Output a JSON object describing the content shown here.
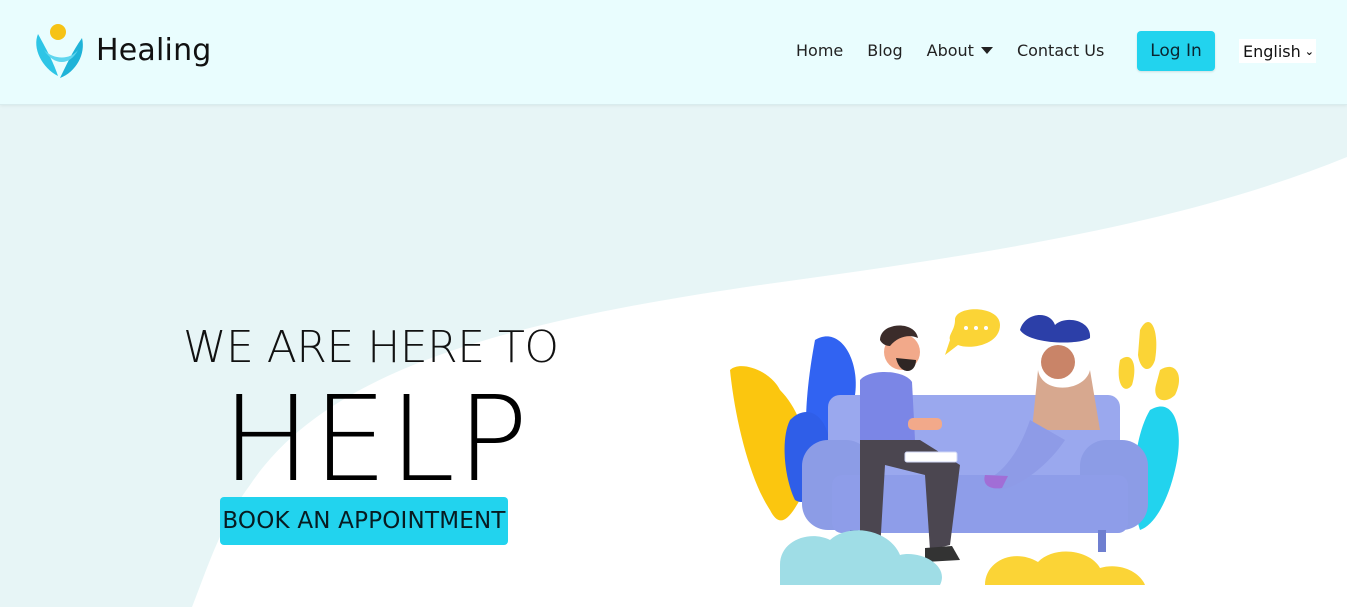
{
  "brand": {
    "name": "Healing"
  },
  "nav": {
    "home": "Home",
    "blog": "Blog",
    "about": "About",
    "contact": "Contact Us",
    "login": "Log In",
    "language": "English"
  },
  "hero": {
    "tagline": "WE ARE HERE TO",
    "headline": "HELP",
    "cta": "BOOK AN APPOINTMENT"
  },
  "colors": {
    "accent": "#22d3ee",
    "header_bg": "#e9fdfe",
    "hero_bg": "#e7f5f6"
  },
  "icons": {
    "logo": "healing-logo-icon",
    "about_dropdown": "caret-down-icon",
    "language_dropdown": "chevron-down-icon",
    "illustration": "therapy-session-illustration"
  }
}
